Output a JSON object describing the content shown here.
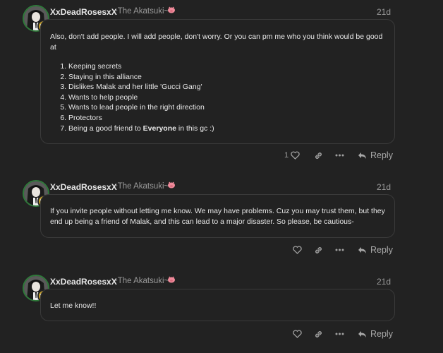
{
  "posts": [
    {
      "username": "XxDeadRosesxX",
      "user_title": "~The Akatsuki~",
      "date": "21d",
      "intro": "Also, don't add people. I will add people, don't worry. Or you can pm me who you think would be good at",
      "list": [
        "Keeping secrets",
        "Staying in this alliance",
        "Dislikes Malak and her little 'Gucci Gang'",
        "Wants to help people",
        "Wants to lead people in the right direction",
        "Protectors",
        "Being a good friend to "
      ],
      "list_bold_word": "Everyone",
      "list_tail": " in this gc :)",
      "like_count": "1",
      "reply_label": "Reply"
    },
    {
      "username": "XxDeadRosesxX",
      "user_title": "~The Akatsuki~",
      "date": "21d",
      "body": "If you invite people without letting me know. We may have problems. Cuz you may trust them, but they end up being a friend of Malak, and this can lead to a major disaster. So please, be cautious-",
      "reply_label": "Reply"
    },
    {
      "username": "XxDeadRosesxX",
      "user_title": "~The Akatsuki~",
      "date": "21d",
      "body": "Let me know!!",
      "reply_label": "Reply"
    }
  ],
  "colors": {
    "background": "#222222",
    "avatar_ring": "#2f7a3a",
    "flair": "#c9a227",
    "pig_emoji": "#f08a9a"
  },
  "icons": [
    "heart-icon",
    "link-icon",
    "more-icon",
    "reply-icon",
    "pig-emoji-icon",
    "flair-icon"
  ]
}
